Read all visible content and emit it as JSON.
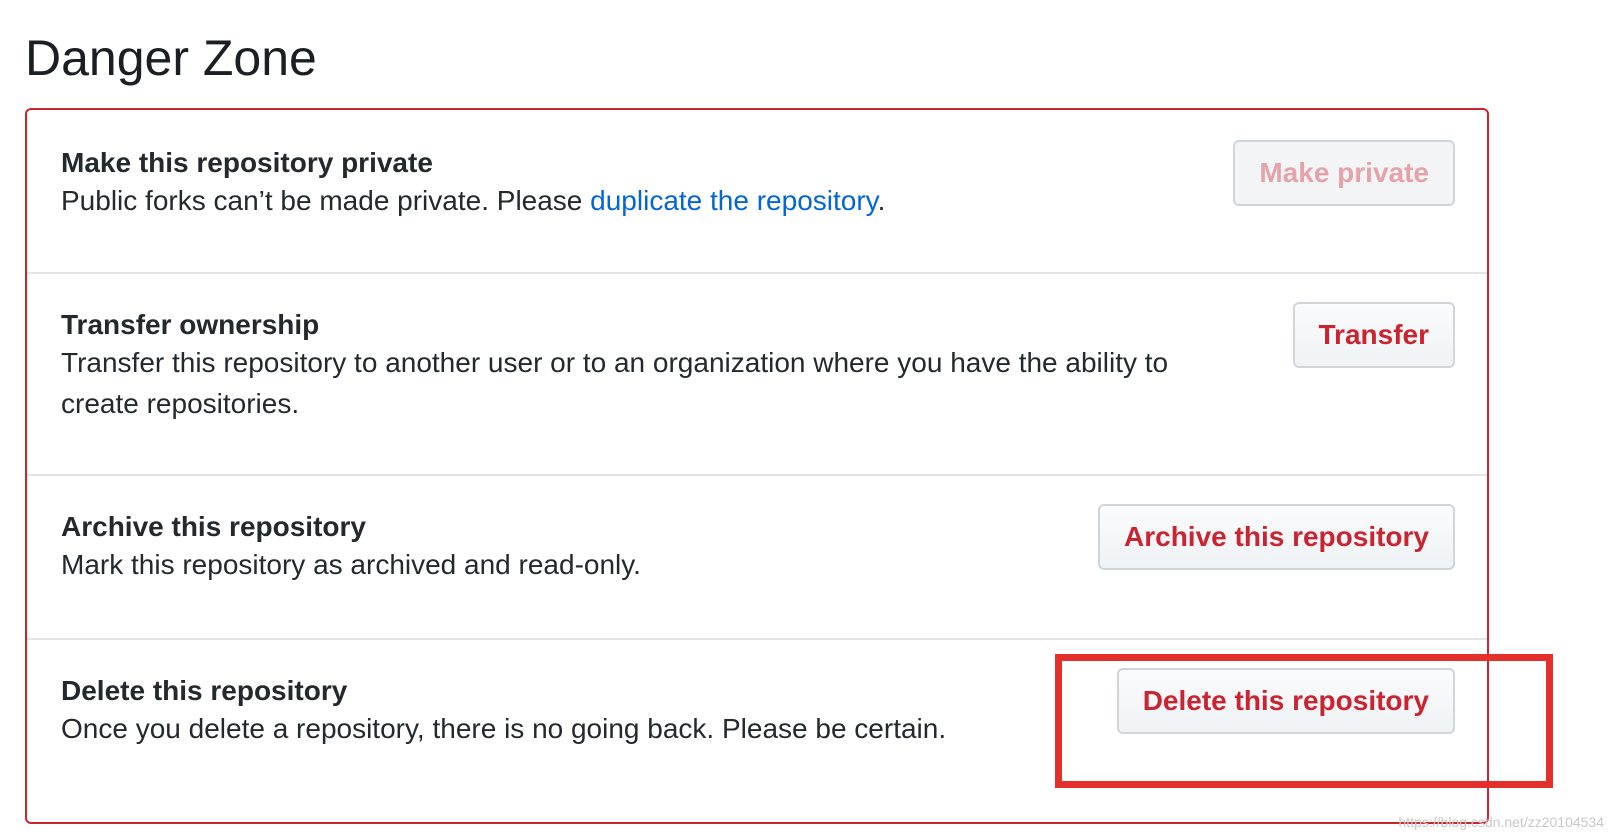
{
  "page": {
    "title": "Danger Zone"
  },
  "rows": [
    {
      "title": "Make this repository private",
      "desc_prefix": "Public forks can’t be made private. Please ",
      "desc_link": "duplicate the repository",
      "desc_suffix": ".",
      "button": "Make private"
    },
    {
      "title": "Transfer ownership",
      "desc_line1": "Transfer this repository to another user or to an organization where you have the ability to",
      "desc_line2": "create repositories.",
      "button": "Transfer"
    },
    {
      "title": "Archive this repository",
      "desc": "Mark this repository as archived and read-only.",
      "button": "Archive this repository"
    },
    {
      "title": "Delete this repository",
      "desc": "Once you delete a repository, there is no going back. Please be certain.",
      "button": "Delete this repository"
    }
  ],
  "watermark": "https://blog.csdn.net/zz20104534",
  "colors": {
    "danger": "#cb2431",
    "link": "#0366d6",
    "highlight": "#e3302b"
  }
}
